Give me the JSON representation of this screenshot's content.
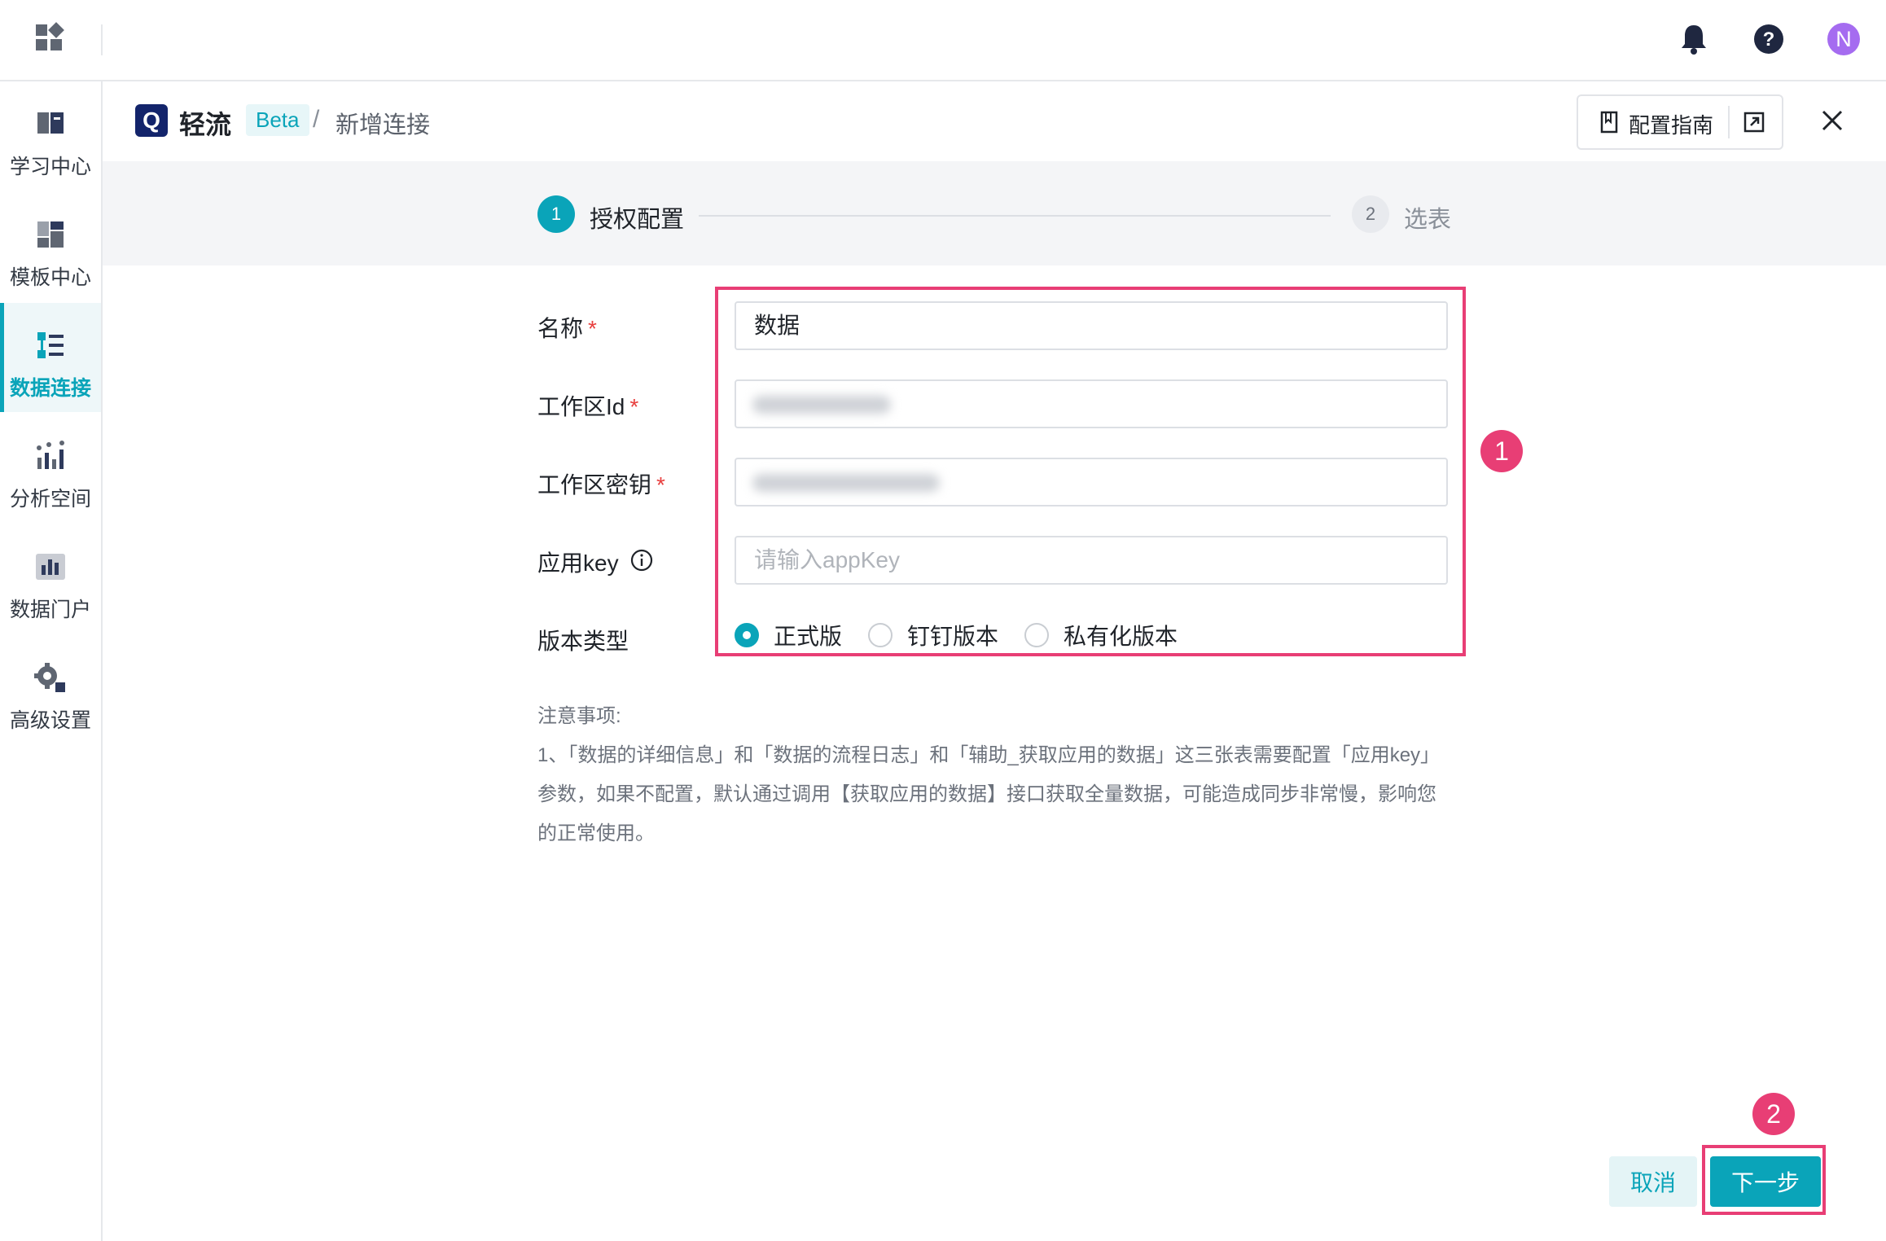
{
  "sidebar": {
    "items": [
      {
        "label": "学习中心",
        "icon": "book-icon"
      },
      {
        "label": "模板中心",
        "icon": "template-icon"
      },
      {
        "label": "数据连接",
        "icon": "data-connect-icon",
        "active": true
      },
      {
        "label": "分析空间",
        "icon": "analysis-icon"
      },
      {
        "label": "数据门户",
        "icon": "portal-icon"
      },
      {
        "label": "高级设置",
        "icon": "gear-icon"
      }
    ]
  },
  "topbar": {
    "avatar_letter": "N"
  },
  "header": {
    "logo_letter": "Q",
    "brand": "轻流",
    "beta": "Beta",
    "separator": "/",
    "crumb": "新增连接",
    "guide_label": "配置指南"
  },
  "steps": [
    {
      "num": "1",
      "label": "授权配置",
      "active": true
    },
    {
      "num": "2",
      "label": "选表",
      "active": false
    }
  ],
  "form": {
    "name_label": "名称",
    "name_value": "数据",
    "workspace_id_label": "工作区Id",
    "workspace_key_label": "工作区密钥",
    "app_key_label": "应用key",
    "app_key_placeholder": "请输入appKey",
    "version_label": "版本类型",
    "required_mark": "*",
    "version_options": [
      "正式版",
      "钉钉版本",
      "私有化版本"
    ],
    "version_selected": "正式版"
  },
  "notes": {
    "title": "注意事项:",
    "line1": "1、「数据的详细信息」和「数据的流程日志」和「辅助_获取应用的数据」这三张表需要配置「应用key」参数，如果不配置，默认通过调用【获取应用的数据】接口获取全量数据，可能造成同步非常慢，影响您的正常使用。"
  },
  "annotations": {
    "badge1": "1",
    "badge2": "2",
    "color": "#e83e75"
  },
  "footer": {
    "cancel": "取消",
    "next": "下一步"
  },
  "colors": {
    "accent": "#0aa4b9",
    "required": "#e8403f"
  }
}
